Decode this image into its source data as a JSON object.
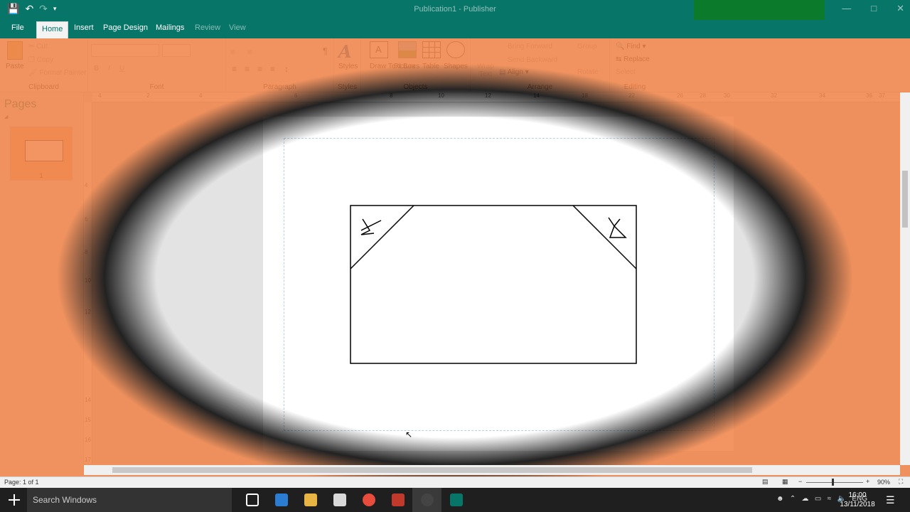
{
  "window": {
    "title": "Publication1 - Publisher"
  },
  "quick_access": {
    "save_icon": "save-icon",
    "undo_icon": "undo-icon",
    "redo_icon": "redo-icon",
    "customize_icon": "customize-icon"
  },
  "tabs": [
    {
      "label": "File"
    },
    {
      "label": "Home"
    },
    {
      "label": "Insert"
    },
    {
      "label": "Page Design"
    },
    {
      "label": "Mailings"
    },
    {
      "label": "Review"
    },
    {
      "label": "View"
    }
  ],
  "ribbon": {
    "clipboard": {
      "paste": "Paste",
      "cut": "Cut",
      "copy": "Copy",
      "format_painter": "Format Painter",
      "label": "Clipboard"
    },
    "font": {
      "bold": "B",
      "italic": "I",
      "underline": "U",
      "label": "Font"
    },
    "paragraph": {
      "label": "Paragraph"
    },
    "styles": {
      "styles": "Styles",
      "label": "Styles"
    },
    "objects": {
      "draw_text_box": "Draw Text Box",
      "pictures": "Pictures",
      "table": "Table",
      "shapes": "Shapes",
      "label": "Objects"
    },
    "arrange": {
      "wrap_text": "Wrap Text",
      "bring_forward": "Bring Forward",
      "send_backward": "Send Backward",
      "group": "Group",
      "rotate": "Rotate",
      "align": "Align",
      "label": "Arrange"
    },
    "editing": {
      "find": "Find",
      "replace": "Replace",
      "select": "Select",
      "label": "Editing"
    }
  },
  "rulers": {
    "horizontal": [
      "4",
      "2",
      "4",
      "6",
      "8",
      "10",
      "12",
      "14",
      "16",
      "18",
      "20",
      "22",
      "24",
      "26",
      "28",
      "30",
      "32",
      "34",
      "36",
      "37"
    ],
    "vertical": [
      "4",
      "6",
      "8",
      "10",
      "12",
      "14",
      "15",
      "16",
      "17"
    ]
  },
  "pages_pane": {
    "title": "Pages",
    "page_number": "1"
  },
  "status_bar": {
    "page": "Page: 1 of 1",
    "zoom": "90%",
    "zoom_level_percent": 90
  },
  "taskbar": {
    "search_placeholder": "Search Windows",
    "language": "ENG",
    "time": "16:00",
    "date": "13/11/2018",
    "apps": [
      {
        "name": "task-view",
        "color": "#ffffff"
      },
      {
        "name": "edge",
        "color": "#2b7cd3"
      },
      {
        "name": "file-explorer",
        "color": "#e8b545"
      },
      {
        "name": "mail",
        "color": "#d9d9d9"
      },
      {
        "name": "chrome",
        "color": "#e74c3c"
      },
      {
        "name": "maps",
        "color": "#c0392b"
      },
      {
        "name": "recorder",
        "color": "#444444"
      },
      {
        "name": "publisher",
        "color": "#077568"
      }
    ]
  }
}
